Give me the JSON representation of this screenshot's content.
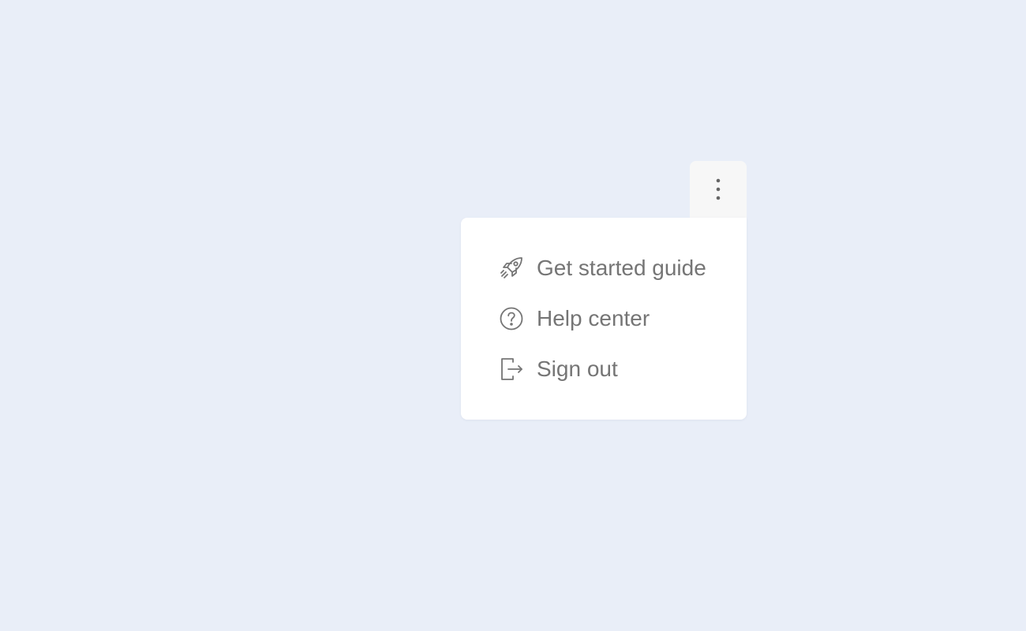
{
  "menu_button": {
    "icon": "more-vertical-icon"
  },
  "menu": {
    "items": [
      {
        "label": "Get started guide",
        "icon": "rocket-icon"
      },
      {
        "label": "Help center",
        "icon": "help-circle-icon"
      },
      {
        "label": "Sign out",
        "icon": "sign-out-icon"
      }
    ]
  },
  "colors": {
    "background": "#e9eef8",
    "menu_background": "#ffffff",
    "button_background": "#f7f7f7",
    "text": "#757575"
  }
}
